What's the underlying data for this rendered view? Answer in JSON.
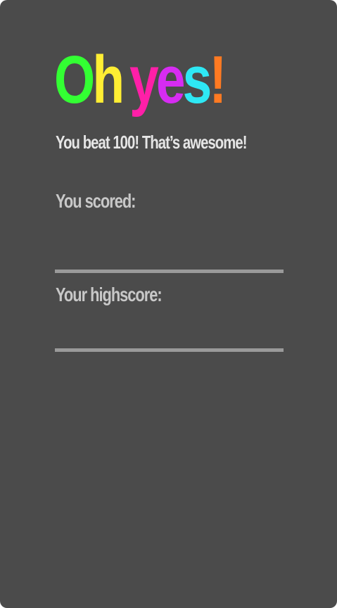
{
  "result": {
    "title_letters": [
      {
        "char": "O",
        "color": "#33ff33"
      },
      {
        "char": "h",
        "color": "#ffee33"
      },
      {
        "char": " ",
        "color": "#ffffff"
      },
      {
        "char": "y",
        "color": "#ff1fa8"
      },
      {
        "char": "e",
        "color": "#d62cf2"
      },
      {
        "char": "s",
        "color": "#2ee8f4"
      },
      {
        "char": "!",
        "color": "#ff7a22"
      }
    ],
    "subtitle": "You beat 100! That’s awesome!"
  },
  "score": {
    "label": "You scored:",
    "value": ""
  },
  "highscore": {
    "label": "Your highscore:",
    "value": ""
  },
  "colors": {
    "panel_background": "#4b4b4b",
    "label_text": "#c8c8c8",
    "divider": "#9a9a9a"
  }
}
